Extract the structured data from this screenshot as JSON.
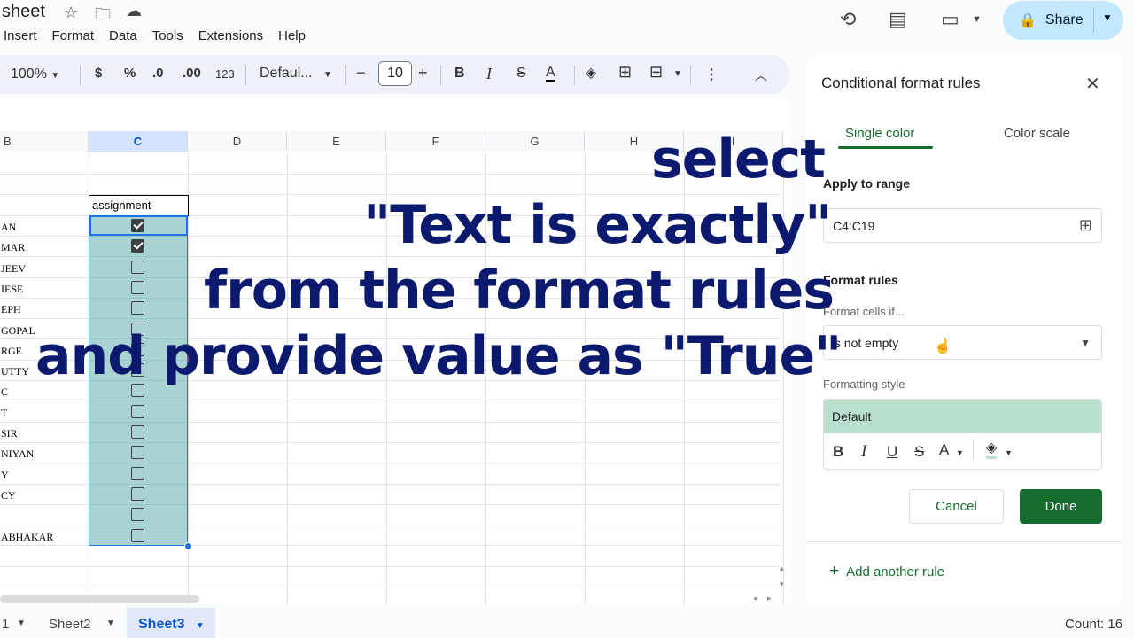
{
  "header": {
    "title": "sheet",
    "menu": [
      "Insert",
      "Format",
      "Data",
      "Tools",
      "Extensions",
      "Help"
    ],
    "share_label": "Share"
  },
  "toolbar": {
    "zoom": "100%",
    "currency": "$",
    "percent": "%",
    "dec_decrease": ".0",
    "dec_increase": ".00",
    "number_format": "123",
    "font": "Defaul...",
    "minus": "−",
    "font_size": "10",
    "plus": "+",
    "bold": "B",
    "italic": "I",
    "strike": "S",
    "text_color": "A"
  },
  "grid": {
    "columns": [
      "B",
      "C",
      "D",
      "E",
      "F",
      "G",
      "H",
      "I"
    ],
    "selected_column": "C",
    "header_cell": "assignment",
    "rows": [
      {
        "name": "AN",
        "checked": true
      },
      {
        "name": "MAR",
        "checked": true
      },
      {
        "name": "JEEV",
        "checked": false
      },
      {
        "name": "IESE",
        "checked": false
      },
      {
        "name": "EPH",
        "checked": false
      },
      {
        "name": " GOPAL",
        "checked": false
      },
      {
        "name": "RGE",
        "checked": false
      },
      {
        "name": "UTTY",
        "checked": false
      },
      {
        "name": "C",
        "checked": false
      },
      {
        "name": " T",
        "checked": false
      },
      {
        "name": "SIR",
        "checked": false
      },
      {
        "name": "NIYAN",
        "checked": false
      },
      {
        "name": "Y",
        "checked": false
      },
      {
        "name": "CY",
        "checked": false
      },
      {
        "name": "",
        "checked": false
      },
      {
        "name": "ABHAKAR",
        "checked": false
      }
    ]
  },
  "sheet_tabs": {
    "tab1": "1",
    "tab2": "Sheet2",
    "tab3": "Sheet3",
    "count": "Count: 16"
  },
  "panel": {
    "title": "Conditional format rules",
    "tab_single": "Single color",
    "tab_scale": "Color scale",
    "apply_label": "Apply to range",
    "range_value": "C4:C19",
    "rules_label": "Format rules",
    "format_if_label": "Format cells if...",
    "condition": "Is not empty",
    "style_label": "Formatting style",
    "style_preview": "Default",
    "style_buttons": {
      "bold": "B",
      "italic": "I",
      "underline": "U",
      "strike": "S",
      "text_color": "A"
    },
    "cancel": "Cancel",
    "done": "Done",
    "add_rule": "Add another rule"
  },
  "overlay": {
    "line1": "select",
    "line2": "\"Text is exactly\"",
    "line3": "from the format rules",
    "line4": "and provide value as \"True\""
  },
  "colors": {
    "accent_green": "#146c2e",
    "selection_fill": "#54a8a6",
    "overlay_text": "#0b1a6e",
    "share_bg": "#c2e7ff"
  }
}
